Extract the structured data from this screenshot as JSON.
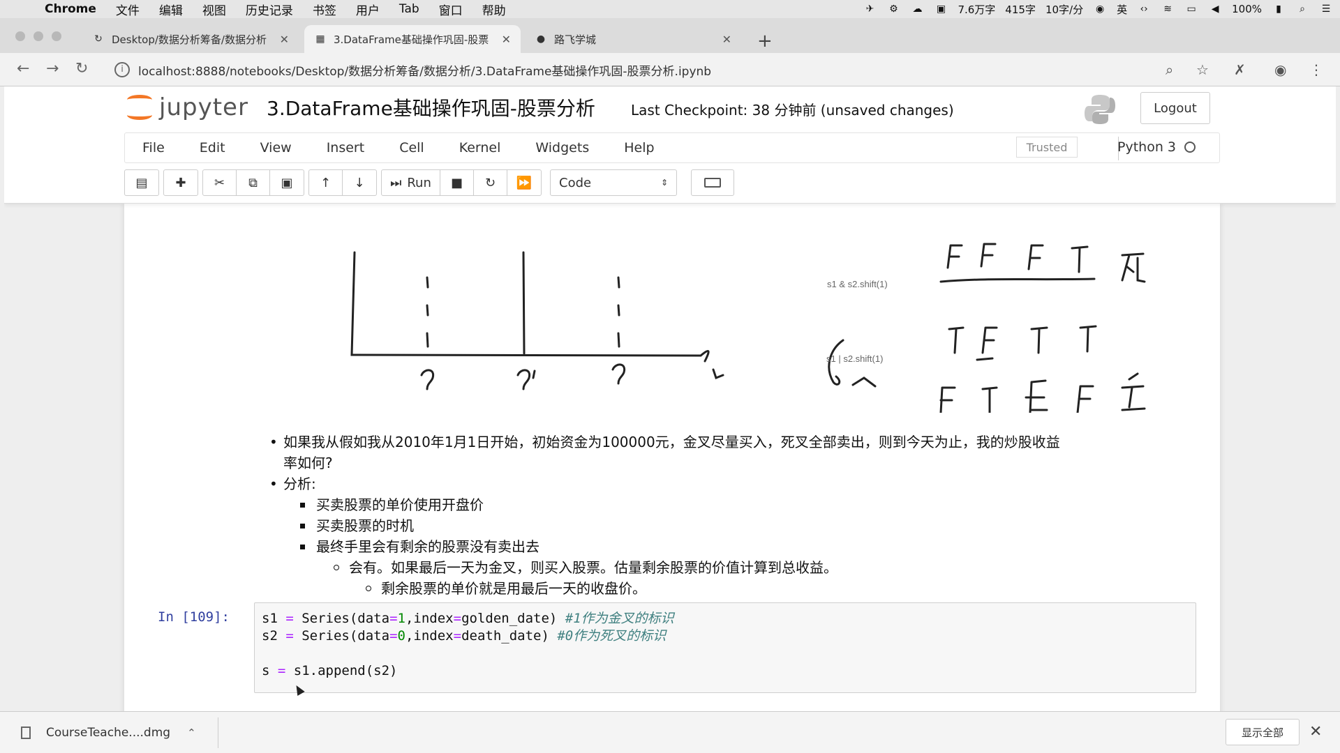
{
  "mac_menu": {
    "app": "Chrome",
    "items": [
      "文件",
      "编辑",
      "视图",
      "历史记录",
      "书签",
      "用户",
      "Tab",
      "窗口",
      "帮助"
    ],
    "status": {
      "words": "7.6万字",
      "count": "415字",
      "speed": "10字/分",
      "lang": "英",
      "battery": "100%"
    }
  },
  "browser": {
    "tabs": [
      {
        "title": "Desktop/数据分析筹备/数据分析",
        "active": false
      },
      {
        "title": "3.DataFrame基础操作巩固-股票",
        "active": true
      },
      {
        "title": "路飞学城",
        "active": false
      }
    ],
    "url": "localhost:8888/notebooks/Desktop/数据分析筹备/数据分析/3.DataFrame基础操作巩固-股票分析.ipynb"
  },
  "jupyter": {
    "logo_text": "jupyter",
    "notebook_name": "3.DataFrame基础操作巩固-股票分析",
    "checkpoint": "Last Checkpoint: 38 分钟前   (unsaved changes)",
    "logout_label": "Logout",
    "menu": [
      "File",
      "Edit",
      "View",
      "Insert",
      "Cell",
      "Kernel",
      "Widgets",
      "Help"
    ],
    "trusted_label": "Trusted",
    "kernel_name": "Python 3",
    "toolbar": {
      "run_label": "Run",
      "cell_type": "Code"
    }
  },
  "drawing": {
    "label_and": "s1 & s2.shift(1)",
    "label_or": "s1 | s2.shift(1)"
  },
  "markdown": {
    "q1": "如果我从假如我从2010年1月1日开始，初始资金为100000元，金叉尽量买入，死叉全部卖出，则到今天为止，我的炒股收益",
    "q1_cont": "率如何?",
    "analysis": "分析:",
    "points": [
      "买卖股票的单价使用开盘价",
      "买卖股票的时机",
      "最终手里会有剩余的股票没有卖出去"
    ],
    "sub": "会有。如果最后一天为金叉，则买入股票。估量剩余股票的价值计算到总收益。",
    "subsub": "剩余股票的单价就是用最后一天的收盘价。"
  },
  "code_cell": {
    "prompt": "In [109]:",
    "line1_a": "s1 ",
    "line1_op": "=",
    "line1_b": " Series(data",
    "line1_op2": "=",
    "line1_num": "1",
    "line1_c": ",index",
    "line1_op3": "=",
    "line1_d": "golden_date) ",
    "line1_com": "#1作为金叉的标识",
    "line2_a": "s2 ",
    "line2_op": "=",
    "line2_b": " Series(data",
    "line2_op2": "=",
    "line2_num": "0",
    "line2_c": ",index",
    "line2_op3": "=",
    "line2_d": "death_date) ",
    "line2_com": "#0作为死叉的标识",
    "line3_a": "s ",
    "line3_op": "=",
    "line3_b": " s1.append(s2)"
  },
  "download": {
    "file": "CourseTeache....dmg",
    "show_all": "显示全部"
  }
}
